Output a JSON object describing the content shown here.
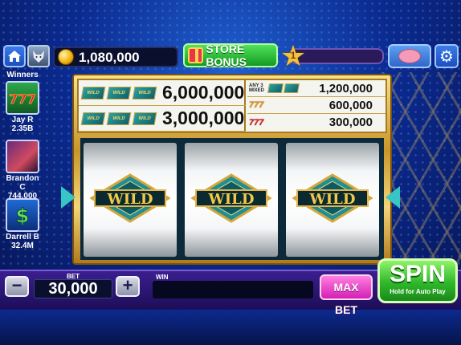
{
  "topbar": {
    "coins": "1,080,000",
    "store_label": "STORE BONUS",
    "level": "1",
    "level_progress": 0.05
  },
  "winners": {
    "title": "Winners",
    "items": [
      {
        "name": "Jay R",
        "amount": "2.35B",
        "icon": "sevens-icon"
      },
      {
        "name": "Brandon C",
        "amount": "744,000",
        "icon": "dragon-icon"
      },
      {
        "name": "Darrell B",
        "amount": "32.4M",
        "icon": "money-icon"
      }
    ]
  },
  "paytable": {
    "big": [
      {
        "symbols": [
          "WILD",
          "WILD",
          "WILD"
        ],
        "payout": "6,000,000"
      },
      {
        "symbols": [
          "WILD",
          "WILD",
          "WILD"
        ],
        "payout": "3,000,000"
      }
    ],
    "small": [
      {
        "tag": "ANY 3 MIXED",
        "payout": "1,200,000"
      },
      {
        "symbols": "777",
        "payout": "600,000"
      },
      {
        "symbols": "777",
        "payout": "300,000"
      }
    ]
  },
  "reels": [
    {
      "symbol": "WILD"
    },
    {
      "symbol": "WILD"
    },
    {
      "symbol": "WILD"
    }
  ],
  "controls": {
    "bet_label": "BET",
    "bet_value": "30,000",
    "minus": "−",
    "plus": "+",
    "win_label": "WIN",
    "win_value": "",
    "maxbet_label": "MAX BET",
    "spin_label": "SPIN",
    "spin_sub": "Hold for Auto Play"
  },
  "colors": {
    "spin": "#2fb82a",
    "maxbet": "#d31fb5",
    "store": "#149a22",
    "background": "#0b2a8f"
  }
}
